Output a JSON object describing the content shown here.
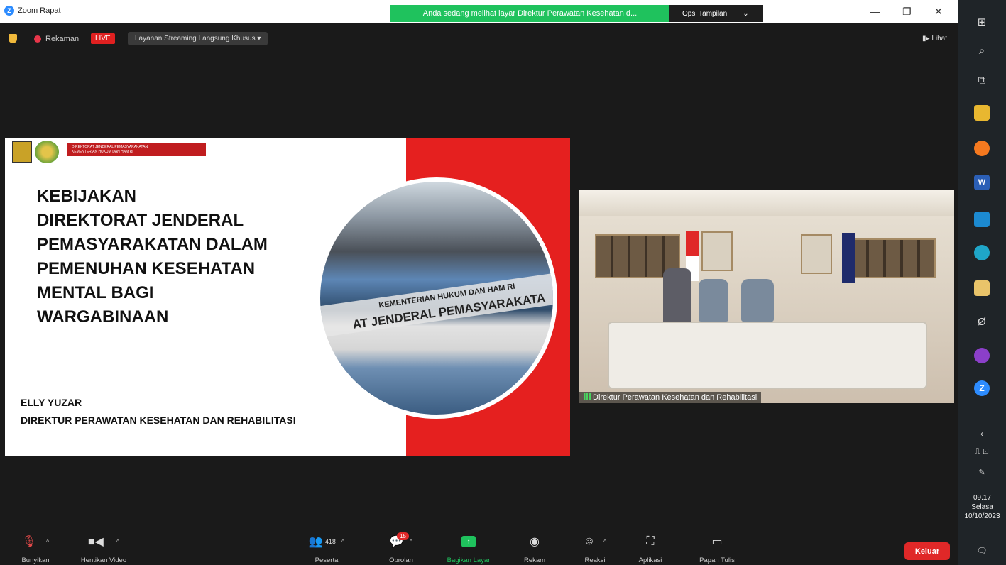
{
  "window": {
    "title": "Zoom Rapat",
    "share_banner": "Anda sedang melihat layar Direktur Perawatan Kesehatan d...",
    "view_options": "Opsi Tampilan",
    "minimize": "—",
    "restore": "❐",
    "close": "✕"
  },
  "meeting_bar": {
    "recording_label": "Rekaman",
    "live_label": "LIVE",
    "stream_button": "Layanan Streaming Langsung Khusus",
    "view_label": "Lihat"
  },
  "slide": {
    "org_name_line1": "DIREKTORAT JENDERAL PEMASYARAKATAN",
    "org_name_line2": "KEMENTERIAN HUKUM DAN HAM RI",
    "title_lines": [
      "KEBIJAKAN",
      "DIREKTORAT JENDERAL",
      "PEMASYARAKATAN DALAM",
      "PEMENUHAN KESEHATAN",
      "MENTAL BAGI",
      "WARGABINAAN"
    ],
    "building_text_line1": "KEMENTERIAN HUKUM DAN HAM RI",
    "building_text_line2": "AT JENDERAL PEMASYARAKATA",
    "speaker_name": "ELLY YUZAR",
    "speaker_role": "DIREKTUR PERAWATAN KESEHATAN DAN REHABILITASI",
    "accent_color": "#e5201f"
  },
  "camera": {
    "participant_label": "Direktur Perawatan Kesehatan dan Rehabilitasi"
  },
  "toolbar": {
    "mute_label": "Bunyikan",
    "stop_video_label": "Hentikan Video",
    "participants_label": "Peserta",
    "participants_count": "418",
    "chat_label": "Obrolan",
    "chat_badge": "15",
    "share_label": "Bagikan Layar",
    "record_label": "Rekam",
    "reactions_label": "Reaksi",
    "apps_label": "Aplikasi",
    "whiteboard_label": "Papan Tulis",
    "leave_label": "Keluar"
  },
  "taskbar": {
    "time": "09.17",
    "day": "Selasa",
    "date": "10/10/2023",
    "icons": [
      "windows-start-icon",
      "search-icon",
      "task-view-icon",
      "file-explorer-icon",
      "firefox-icon",
      "word-icon",
      "mail-icon",
      "edge-icon",
      "store-icon",
      "app-icon",
      "copilot-icon",
      "zoom-icon"
    ]
  }
}
